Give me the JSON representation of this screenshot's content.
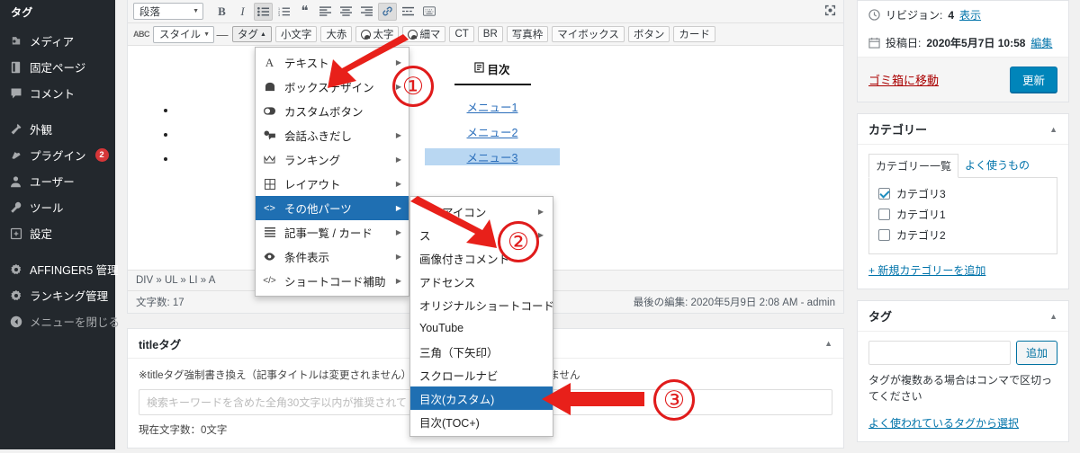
{
  "sidebar": {
    "title": "タグ",
    "items": [
      {
        "label": "メディア",
        "icon": "media-icon",
        "badge": null,
        "dim": false
      },
      {
        "label": "固定ページ",
        "icon": "page-icon",
        "badge": null,
        "dim": false
      },
      {
        "label": "コメント",
        "icon": "comment-icon",
        "badge": null,
        "dim": false
      },
      {
        "label": "外観",
        "icon": "appearance-icon",
        "badge": null,
        "dim": false
      },
      {
        "label": "プラグイン",
        "icon": "plugin-icon",
        "badge": "2",
        "dim": false
      },
      {
        "label": "ユーザー",
        "icon": "user-icon",
        "badge": null,
        "dim": false
      },
      {
        "label": "ツール",
        "icon": "tools-icon",
        "badge": null,
        "dim": false
      },
      {
        "label": "設定",
        "icon": "settings-icon",
        "badge": null,
        "dim": false
      },
      {
        "label": "AFFINGER5 管理",
        "icon": "gear-icon",
        "badge": null,
        "dim": false
      },
      {
        "label": "ランキング管理",
        "icon": "gear-icon",
        "badge": null,
        "dim": false
      },
      {
        "label": "メニューを閉じる",
        "icon": "collapse-icon",
        "badge": null,
        "dim": true
      }
    ]
  },
  "toolbar": {
    "format_select": "段落",
    "row1": [
      {
        "name": "bold-button",
        "glyph": "B",
        "active": false
      },
      {
        "name": "italic-button",
        "glyph": "I",
        "active": false
      },
      {
        "name": "bulleted-list-button",
        "glyph": "≔",
        "active": true
      },
      {
        "name": "numbered-list-button",
        "glyph": "≕",
        "active": false
      },
      {
        "name": "blockquote-button",
        "glyph": "❝",
        "active": false
      },
      {
        "name": "align-left-button",
        "glyph": "≡",
        "active": false
      },
      {
        "name": "align-center-button",
        "glyph": "≡",
        "active": false
      },
      {
        "name": "align-right-button",
        "glyph": "≡",
        "active": false
      },
      {
        "name": "insert-link-button",
        "glyph": "🔗",
        "active": true
      },
      {
        "name": "read-more-button",
        "glyph": "▭",
        "active": false
      },
      {
        "name": "keyboard-shortcuts-button",
        "glyph": "⌨",
        "active": false
      }
    ],
    "fullscreen_icon": "fullscreen-icon",
    "row2": {
      "strikethrough_label": "ABC",
      "style_label": "スタイル",
      "dash_label": "—",
      "tag_label": "タグ",
      "hidden_label": "小文字",
      "buttons": [
        "大赤",
        "太字",
        "細マ",
        "CT",
        "BR",
        "写真枠",
        "マイボックス",
        "ボタン",
        "カード"
      ]
    }
  },
  "menu1": {
    "items": [
      {
        "label": "テキスト",
        "icon": "text-icon",
        "submenu": true,
        "highlight": false
      },
      {
        "label": "ボックスデザイン",
        "icon": "box-icon",
        "submenu": true,
        "highlight": false
      },
      {
        "label": "カスタムボタン",
        "icon": "toggle-icon",
        "submenu": false,
        "highlight": false
      },
      {
        "label": "会話ふきだし",
        "icon": "speech-icon",
        "submenu": true,
        "highlight": false
      },
      {
        "label": "ランキング",
        "icon": "crown-icon",
        "submenu": true,
        "highlight": false
      },
      {
        "label": "レイアウト",
        "icon": "grid-icon",
        "submenu": true,
        "highlight": false
      },
      {
        "label": "その他パーツ",
        "icon": "code-icon",
        "submenu": true,
        "highlight": true
      },
      {
        "label": "記事一覧 / カード",
        "icon": "list-icon",
        "submenu": true,
        "highlight": false
      },
      {
        "label": "条件表示",
        "icon": "eye-icon",
        "submenu": true,
        "highlight": false
      },
      {
        "label": "ショートコード補助",
        "icon": "shortcode-icon",
        "submenu": true,
        "highlight": false
      }
    ]
  },
  "menu2": {
    "items": [
      {
        "label": "アイコン",
        "submenu": true,
        "highlight": false
      },
      {
        "label": "ス",
        "submenu": true,
        "highlight": false
      },
      {
        "label": "画像付きコメント",
        "submenu": false,
        "highlight": false
      },
      {
        "label": "アドセンス",
        "submenu": false,
        "highlight": false
      },
      {
        "label": "オリジナルショートコード",
        "submenu": false,
        "highlight": false
      },
      {
        "label": "YouTube",
        "submenu": false,
        "highlight": false
      },
      {
        "label": "三角（下矢印）",
        "submenu": false,
        "highlight": false
      },
      {
        "label": "スクロールナビ",
        "submenu": false,
        "highlight": false
      },
      {
        "label": "目次(カスタム)",
        "submenu": false,
        "highlight": true
      },
      {
        "label": "目次(TOC+)",
        "submenu": false,
        "highlight": false
      }
    ]
  },
  "canvas": {
    "toc_heading": "目次",
    "toc_icon": "document-icon",
    "links": [
      {
        "label": "メニュー1",
        "selected": false
      },
      {
        "label": "メニュー2",
        "selected": false
      },
      {
        "label": "メニュー3",
        "selected": true
      }
    ],
    "link_tools": [
      {
        "name": "anchor-icon",
        "glyph": "#"
      },
      {
        "name": "edit-icon",
        "glyph": "✎"
      },
      {
        "name": "unlink-icon",
        "glyph": "⛓"
      }
    ],
    "breadcrumb": "DIV » UL » LI » A",
    "word_count": "文字数: 17",
    "last_edit": "最後の編集: 2020年5月9日 2:08 AM - admin"
  },
  "title_tag_box": {
    "heading": "titleタグ",
    "note": "※titleタグ強制書き換え（記事タイトルは変更されません）",
    "note_tail": "ません",
    "placeholder": "検索キーワードを含めた全角30文字以内が推奨されて",
    "value": "",
    "count": "現在文字数：0文字",
    "toggle_icon": "chevron-up-icon"
  },
  "publish": {
    "revision_icon": "clock-icon",
    "revision_label": "リビジョン:",
    "revision_count": "4",
    "revision_link": "表示",
    "date_icon": "calendar-icon",
    "date_label": "投稿日:",
    "date_value": "2020年5月7日 10:58",
    "date_link": "編集",
    "trash_link": "ゴミ箱に移動",
    "update_button": "更新"
  },
  "categories": {
    "heading": "カテゴリー",
    "toggle_icon": "chevron-up-icon",
    "tabs": [
      {
        "label": "カテゴリー一覧",
        "active": true
      },
      {
        "label": "よく使うもの",
        "active": false
      }
    ],
    "items": [
      {
        "label": "カテゴリ3",
        "checked": true
      },
      {
        "label": "カテゴリ1",
        "checked": false
      },
      {
        "label": "カテゴリ2",
        "checked": false
      }
    ],
    "add_link": "+ 新規カテゴリーを追加"
  },
  "tags_panel": {
    "heading": "タグ",
    "toggle_icon": "chevron-up-icon",
    "input_value": "",
    "add_button": "追加",
    "hint": "タグが複数ある場合はコンマで区切ってください",
    "choose_link": "よく使われているタグから選択"
  },
  "annotations": [
    {
      "label": "①"
    },
    {
      "label": "②"
    },
    {
      "label": "③"
    }
  ],
  "colors": {
    "admin_bar": "#23282d",
    "accent_blue": "#0085ba",
    "menu_highlight": "#1f6fb2",
    "annotation_red": "#e01b1b",
    "badge_red": "#d63638"
  }
}
